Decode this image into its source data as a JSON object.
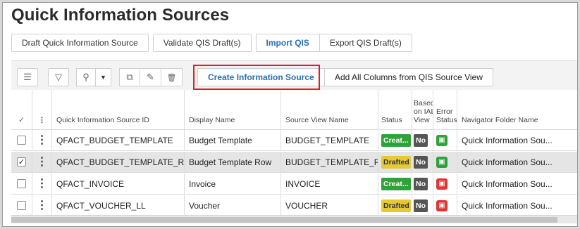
{
  "title": "Quick Information Sources",
  "commands": {
    "draft": "Draft Quick Information Source",
    "validate": "Validate QIS Draft(s)",
    "import": "Import QIS",
    "export": "Export QIS Draft(s)"
  },
  "toolbar": {
    "list_icon": "☰",
    "filter_icon": "▽",
    "connect_icon": "⚲",
    "dropdown_icon": "▼",
    "open_icon": "⧉",
    "edit_icon": "✎",
    "delete_icon": "🗑",
    "create_label": "Create Information Source",
    "add_columns_label": "Add All Columns from QIS Source View"
  },
  "table": {
    "headers": {
      "check": "✓",
      "menu": "⋮",
      "id": "Quick Information Source ID",
      "display": "Display Name",
      "view": "Source View Name",
      "status": "Status",
      "ial_1": "Based",
      "ial_2": "on IAL",
      "ial_3": "View",
      "err_1": "Error",
      "err_2": "Status",
      "folder": "Navigator Folder Name"
    },
    "rows": [
      {
        "id": "QFACT_BUDGET_TEMPLATE",
        "display": "Budget Template",
        "view": "BUDGET_TEMPLATE",
        "status": "Creat...",
        "ial": "No",
        "err": "ok",
        "folder": "Quick Information Sou...",
        "selected": false
      },
      {
        "id": "QFACT_BUDGET_TEMPLATE_ROW",
        "display": "Budget Template Row",
        "view": "BUDGET_TEMPLATE_R...",
        "status": "Drafted",
        "ial": "No",
        "err": "ok",
        "folder": "Quick Information Sou...",
        "selected": true
      },
      {
        "id": "QFACT_INVOICE",
        "display": "Invoice",
        "view": "INVOICE",
        "status": "Creat...",
        "ial": "No",
        "err": "error",
        "folder": "Quick Information Sou...",
        "selected": false
      },
      {
        "id": "QFACT_VOUCHER_LL",
        "display": "Voucher",
        "view": "VOUCHER",
        "status": "Drafted",
        "ial": "No",
        "err": "error",
        "folder": "Quick Information Sou...",
        "selected": false
      }
    ]
  },
  "colors": {
    "created": "#2fa23a",
    "drafted": "#e6c935",
    "error": "#e03535",
    "highlight": "#e01e1e",
    "accent": "#2a6fb5"
  }
}
